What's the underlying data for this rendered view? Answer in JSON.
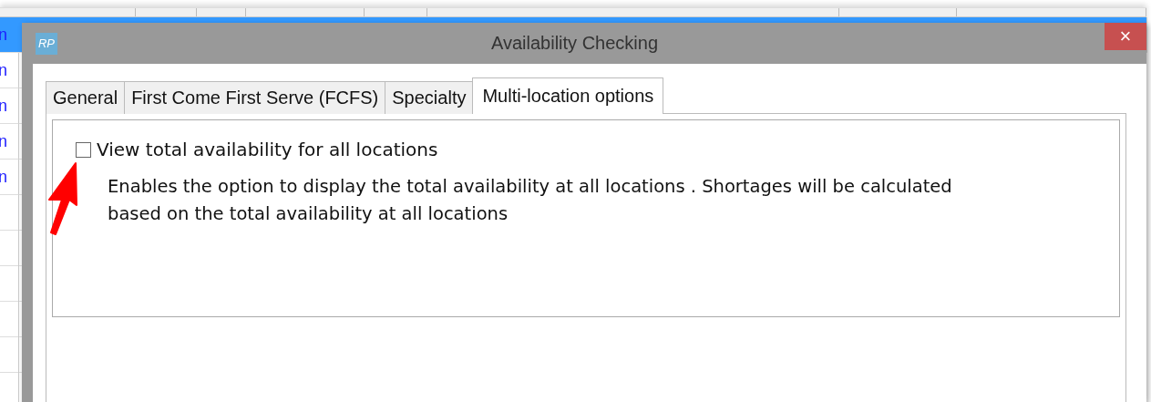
{
  "background_table": {
    "rows": [
      {
        "column_1": "n",
        "selected": true
      },
      {
        "column_1": "n",
        "selected": false
      },
      {
        "column_1": "n",
        "selected": false
      },
      {
        "column_1": "n",
        "selected": false
      },
      {
        "column_1": "n",
        "selected": false
      }
    ]
  },
  "dialog": {
    "title": "Availability Checking",
    "app_badge": "RP",
    "close": "×",
    "tabs": [
      {
        "label": "General",
        "selected": false
      },
      {
        "label": "First Come First Serve (FCFS)",
        "selected": false
      },
      {
        "label": "Specialty",
        "selected": false
      },
      {
        "label": "Multi-location options",
        "selected": true
      }
    ],
    "option": {
      "label": "View total availability for all locations",
      "checked": false,
      "description": "Enables the option to display the total availability at all locations . Shortages will be calculated based on the total availability at all locations"
    }
  }
}
